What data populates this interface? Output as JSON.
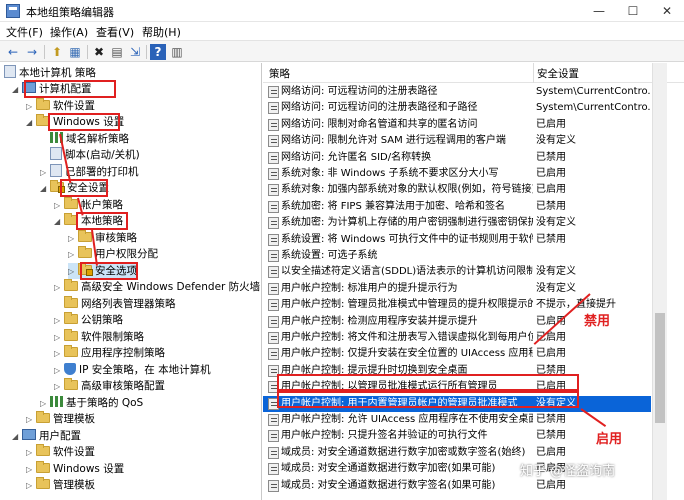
{
  "window": {
    "title": "本地组策略编辑器"
  },
  "menu": [
    "文件(F)",
    "操作(A)",
    "查看(V)",
    "帮助(H)"
  ],
  "toolbar": {
    "back": "←",
    "forward": "→",
    "up": "⬆",
    "show_hide": "▦",
    "delete": "✖",
    "properties": "▤",
    "export": "⇲",
    "help": "?",
    "filter": "▥"
  },
  "tree": [
    {
      "label": "本地计算机 策略"
    },
    {
      "label": "计算机配置"
    },
    {
      "label": "软件设置"
    },
    {
      "label": "Windows 设置"
    },
    {
      "label": "域名解析策略"
    },
    {
      "label": "脚本(启动/关机)"
    },
    {
      "label": "已部署的打印机"
    },
    {
      "label": "安全设置"
    },
    {
      "label": "帐户策略"
    },
    {
      "label": "本地策略"
    },
    {
      "label": "审核策略"
    },
    {
      "label": "用户权限分配"
    },
    {
      "label": "安全选项"
    },
    {
      "label": "高级安全 Windows Defender 防火墙"
    },
    {
      "label": "网络列表管理器策略"
    },
    {
      "label": "公钥策略"
    },
    {
      "label": "软件限制策略"
    },
    {
      "label": "应用程序控制策略"
    },
    {
      "label": "IP 安全策略，在 本地计算机"
    },
    {
      "label": "高级审核策略配置"
    },
    {
      "label": "基于策略的 QoS"
    },
    {
      "label": "管理模板"
    },
    {
      "label": "用户配置"
    },
    {
      "label": "软件设置"
    },
    {
      "label": "Windows 设置"
    },
    {
      "label": "管理模板"
    }
  ],
  "list": {
    "col_policy": "策略",
    "col_setting": "安全设置",
    "rows": [
      {
        "policy": "网络访问: 可远程访问的注册表路径",
        "setting": "System\\CurrentContro..."
      },
      {
        "policy": "网络访问: 可远程访问的注册表路径和子路径",
        "setting": "System\\CurrentContro..."
      },
      {
        "policy": "网络访问: 限制对命名管道和共享的匿名访问",
        "setting": "已启用"
      },
      {
        "policy": "网络访问: 限制允许对 SAM 进行远程调用的客户端",
        "setting": "没有定义"
      },
      {
        "policy": "网络访问: 允许匿名 SID/名称转换",
        "setting": "已禁用"
      },
      {
        "policy": "系统对象: 非 Windows 子系统不要求区分大小写",
        "setting": "已启用"
      },
      {
        "policy": "系统对象: 加强内部系统对象的默认权限(例如，符号链接)",
        "setting": "已启用"
      },
      {
        "policy": "系统加密: 将 FIPS 兼容算法用于加密、哈希和签名",
        "setting": "已禁用"
      },
      {
        "policy": "系统加密: 为计算机上存储的用户密钥强制进行强密钥保护",
        "setting": "没有定义"
      },
      {
        "policy": "系统设置: 将 Windows 可执行文件中的证书规则用于软件...",
        "setting": "已禁用"
      },
      {
        "policy": "系统设置: 可选子系统",
        "setting": ""
      },
      {
        "policy": "以安全描述符定义语言(SDDL)语法表示的计算机访问限制",
        "setting": "没有定义"
      },
      {
        "policy": "用户帐户控制: 标准用户的提升提示行为",
        "setting": "没有定义"
      },
      {
        "policy": "用户帐户控制: 管理员批准模式中管理员的提升权限提示的...",
        "setting": "不提示，直接提升"
      },
      {
        "policy": "用户帐户控制: 检测应用程序安装并提示提升",
        "setting": "已启用"
      },
      {
        "policy": "用户帐户控制: 将文件和注册表写入错误虚拟化到每用户位置",
        "setting": "已启用"
      },
      {
        "policy": "用户帐户控制: 仅提升安装在安全位置的 UIAccess 应用程序",
        "setting": "已启用"
      },
      {
        "policy": "用户帐户控制: 提示提升时切换到安全桌面",
        "setting": "已禁用"
      },
      {
        "policy": "用户帐户控制: 以管理员批准模式运行所有管理员",
        "setting": "已启用"
      },
      {
        "policy": "用户帐户控制: 用于内置管理员帐户的管理员批准模式",
        "setting": "没有定义"
      },
      {
        "policy": "用户帐户控制: 允许 UIAccess 应用程序在不使用安全桌面...",
        "setting": "已禁用"
      },
      {
        "policy": "用户帐户控制: 只提升签名并验证的可执行文件",
        "setting": "已禁用"
      },
      {
        "policy": "域成员: 对安全通道数据进行数字加密或数字签名(始终)",
        "setting": "已启用"
      },
      {
        "policy": "域成员: 对安全通道数据进行数字加密(如果可能)",
        "setting": "已启用"
      },
      {
        "policy": "域成员: 对安全通道数据进行数字签名(如果可能)",
        "setting": "已启用"
      }
    ]
  },
  "annotations": {
    "disable": "禁用",
    "enable": "启用"
  },
  "watermark": "知乎 @怪盗询南"
}
